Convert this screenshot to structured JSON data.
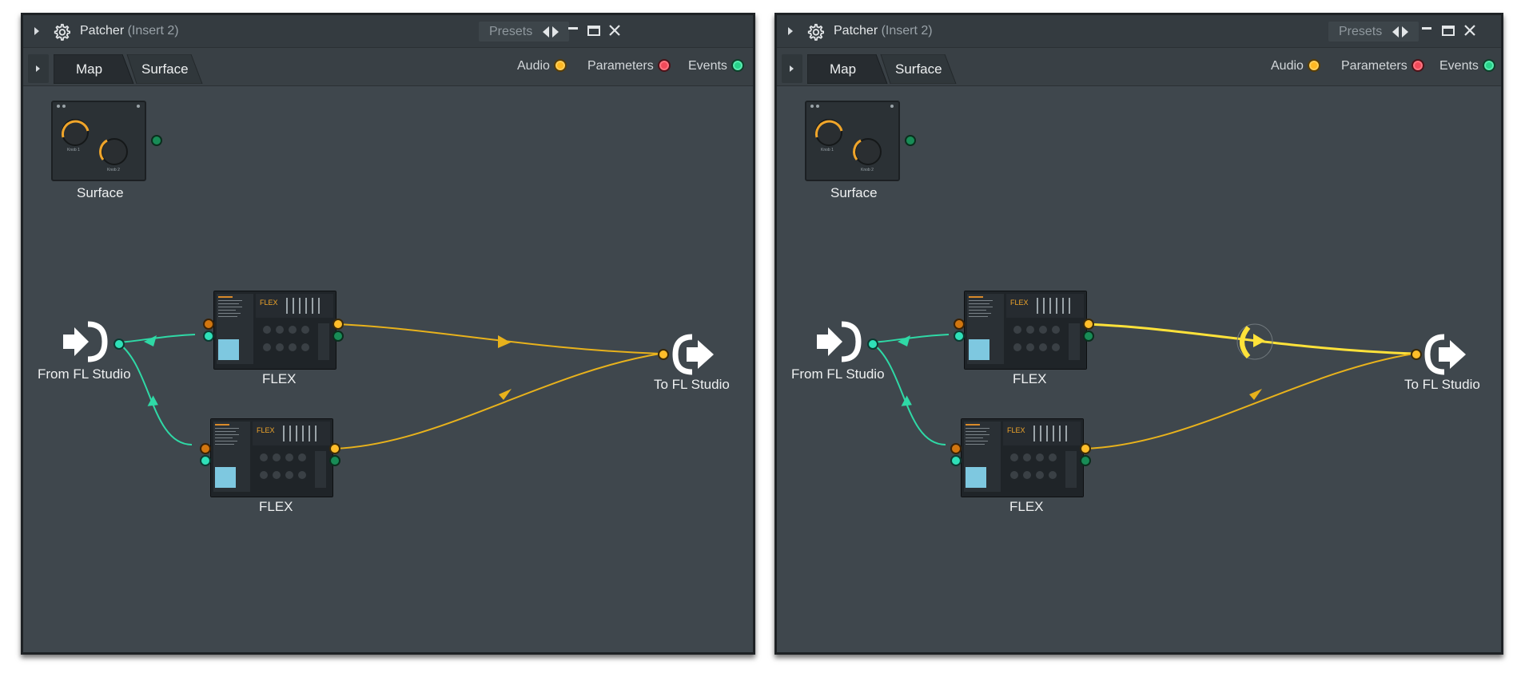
{
  "windows": [
    {
      "title": "Patcher",
      "title_sub": "(Insert 2)",
      "presets_label": "Presets",
      "tabs": [
        {
          "label": "Map",
          "active": true
        },
        {
          "label": "Surface",
          "active": false
        }
      ],
      "toggles": [
        {
          "label": "Audio",
          "color": "#ffb822"
        },
        {
          "label": "Parameters",
          "color": "#f24a5a"
        },
        {
          "label": "Events",
          "color": "#27d38a"
        }
      ],
      "nodes": {
        "surface": {
          "label": "Surface",
          "knob1": "Knob 1",
          "knob2": "Knob 2"
        },
        "input": {
          "label": "From FL Studio"
        },
        "flex_top": {
          "label": "FLEX"
        },
        "flex_bottom": {
          "label": "FLEX"
        },
        "output": {
          "label": "To FL Studio"
        }
      }
    },
    {
      "title": "Patcher",
      "title_sub": "(Insert 2)",
      "presets_label": "Presets",
      "tabs": [
        {
          "label": "Map",
          "active": true
        },
        {
          "label": "Surface",
          "active": false
        }
      ],
      "toggles": [
        {
          "label": "Audio",
          "color": "#ffb822"
        },
        {
          "label": "Parameters",
          "color": "#f24a5a"
        },
        {
          "label": "Events",
          "color": "#27d38a"
        }
      ],
      "nodes": {
        "surface": {
          "label": "Surface",
          "knob1": "Knob 1",
          "knob2": "Knob 2"
        },
        "input": {
          "label": "From FL Studio"
        },
        "flex_top": {
          "label": "FLEX"
        },
        "flex_bottom": {
          "label": "FLEX"
        },
        "output": {
          "label": "To FL Studio"
        }
      },
      "highlighted_connection": "flex_top-to-output"
    }
  ],
  "colors": {
    "audio_wire": "#e8b21c",
    "event_wire": "#2fd9a6",
    "highlight_wire": "#ffe23a",
    "window_bg": "#3f474d"
  },
  "icons": [
    "gear-icon",
    "chevron-left-icon",
    "chevron-right-icon",
    "minimize-icon",
    "maximize-icon",
    "close-icon",
    "input-plug-icon",
    "output-plug-icon",
    "cut-cursor-icon"
  ]
}
